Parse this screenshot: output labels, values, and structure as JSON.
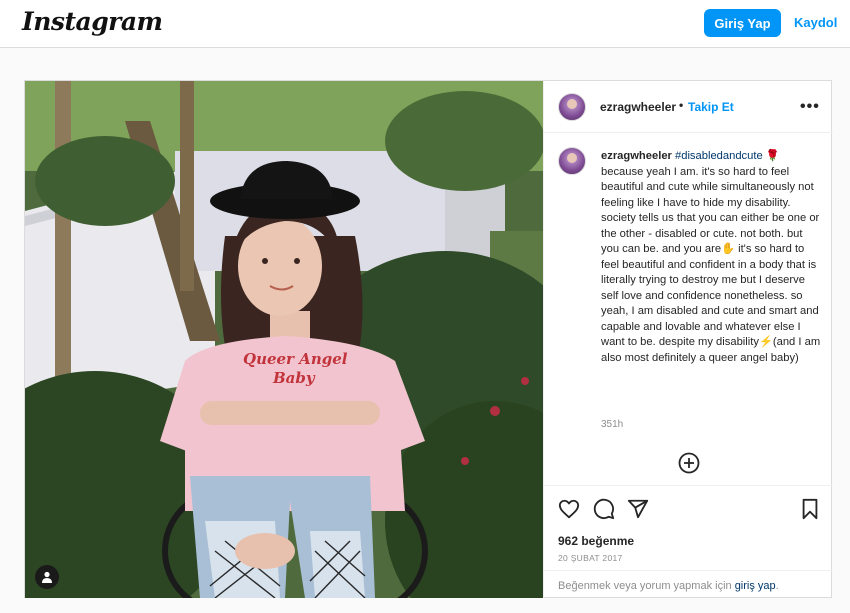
{
  "header": {
    "logo_text": "Instagram",
    "login_label": "Giriş Yap",
    "signup_label": "Kaydol"
  },
  "post": {
    "username": "ezragwheeler",
    "dot": "•",
    "follow_label": "Takip Et",
    "more_icon": "more-horizontal-icon",
    "caption_hashtag": "#disabledandcute",
    "caption_line1": "because yeah I am. it's so hard to feel beautiful and cute while simultaneously not feeling like I have to hide my disability. society tells us that you can either be one or the other - disabled or cute. not both. but you can be. and you are",
    "caption_line2": " it's so hard to feel beautiful and confident in a body that is literally trying to destroy me but I deserve self love and confidence nonetheless. so yeah, I am disabled and cute and smart and capable and lovable and whatever else I want to be. despite my disability",
    "caption_line3": "(and I am also most definitely a queer angel baby)",
    "emoji_rose": "🌹",
    "emoji_hand": "✋",
    "emoji_bolt": "⚡",
    "time_ago": "351h",
    "likes": "962 beğenme",
    "date": "20 ŞUBAT 2017",
    "login_prompt_prefix": "Beğenmek veya yorum yapmak için ",
    "login_prompt_link": "giriş yap",
    "login_prompt_suffix": ".",
    "shirt_text_line1": "Queer Angel",
    "shirt_text_line2": "Baby"
  },
  "colors": {
    "accent": "#0095f6",
    "link_dark": "#00376b",
    "muted": "#8e8e8e"
  }
}
